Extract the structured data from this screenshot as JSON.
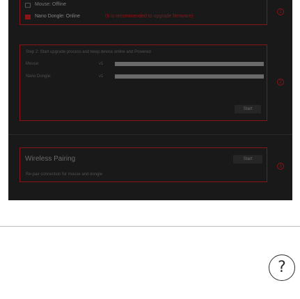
{
  "status": {
    "mouse": "Mouse: Offline",
    "dongle": "Nano Dongle: Online",
    "dongle_hint": "(It is recommended to upgrade firmware)"
  },
  "steps": {
    "step1_icon": "1",
    "step2_icon": "2",
    "step3_icon": "3"
  },
  "update": {
    "instruction": "Step 2: Start upgrade process and keep device online and Powered",
    "mouse_label": "Mouse:",
    "mouse_value": "v1",
    "dongle_label": "Nano Dongle:",
    "dongle_value": "v1",
    "start_button": "Start"
  },
  "pairing": {
    "title": "Wireless Pairing",
    "description": "Re-pair connection for mouse and dongle",
    "start_button": "Start"
  },
  "help_icon": "?"
}
